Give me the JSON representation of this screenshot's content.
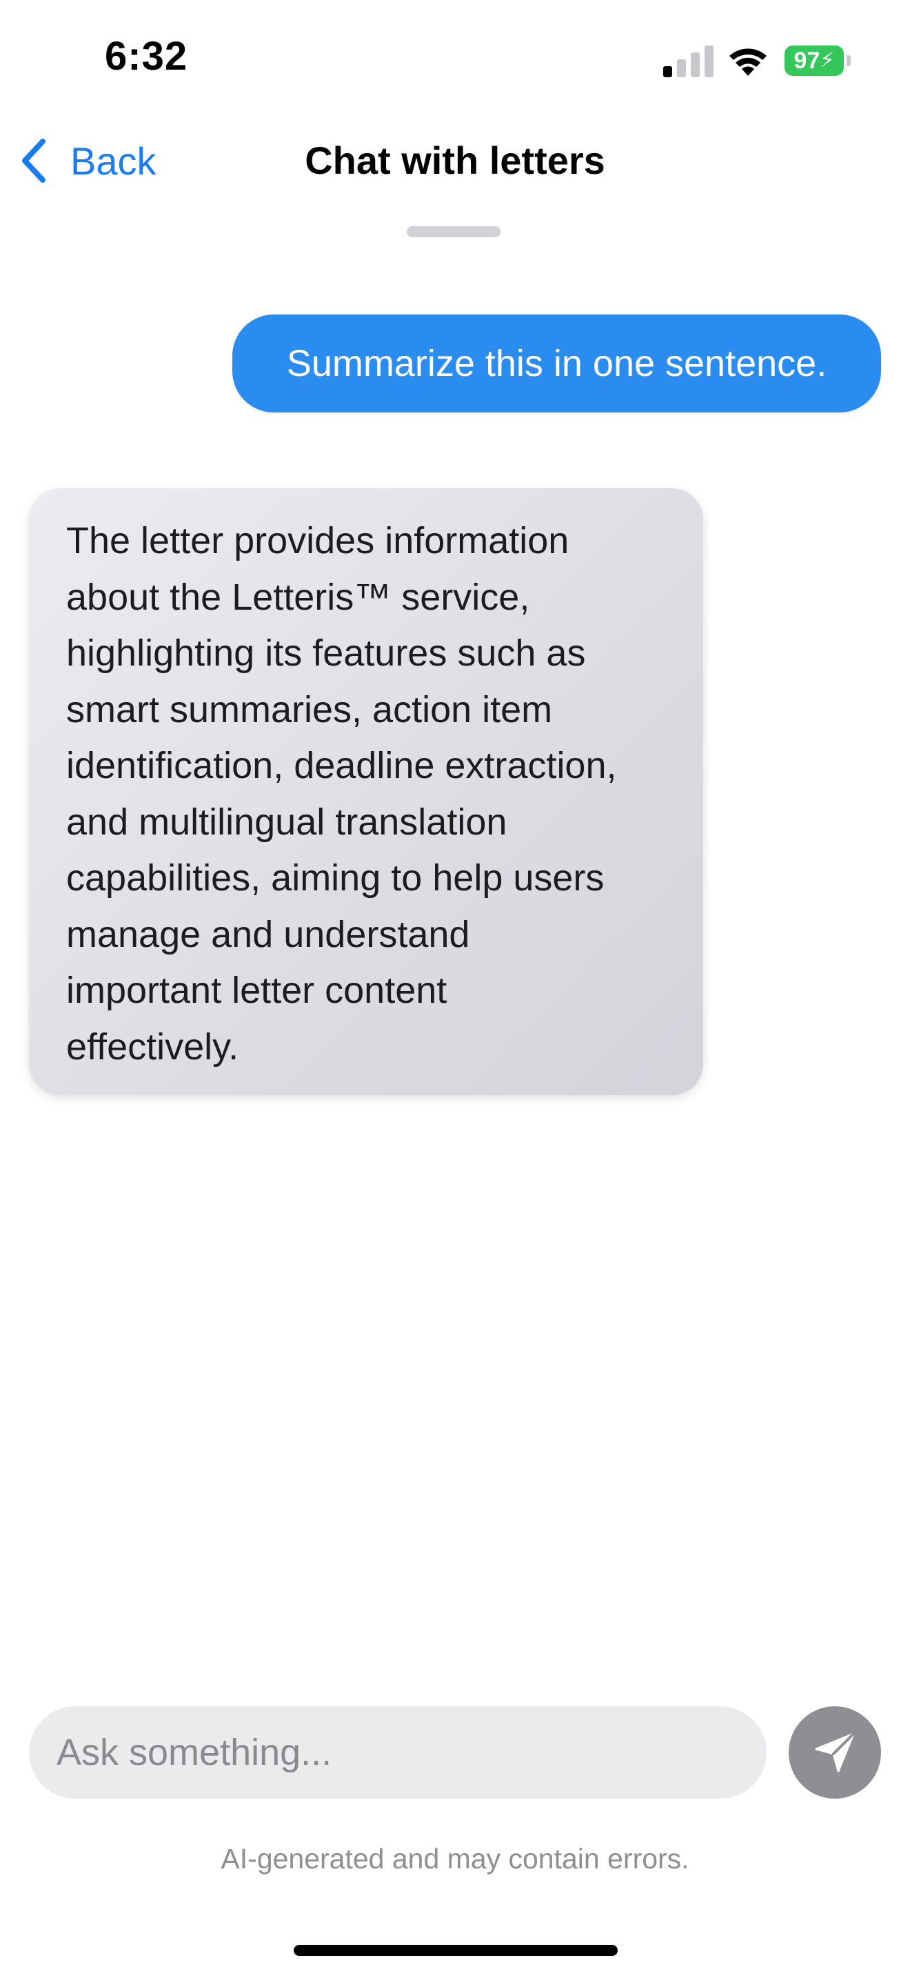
{
  "status_bar": {
    "time": "6:32",
    "battery_level": "97",
    "battery_color": "#34c759",
    "signal_icon": "cellular-signal-icon",
    "wifi_icon": "wifi-icon"
  },
  "nav": {
    "back_label": "Back",
    "back_icon": "chevron-left-icon",
    "title": "Chat with letters",
    "accent_color": "#1a7cf2"
  },
  "messages": [
    {
      "role": "user",
      "text": "Summarize this in one sentence."
    },
    {
      "role": "assistant",
      "lines": [
        "The letter provides information",
        "about the Letteris™ service,",
        "highlighting its features such as",
        "smart summaries, action item",
        "identification, deadline extraction,",
        "and multilingual translation",
        "capabilities, aiming to help users",
        "manage and understand",
        "important letter content",
        "effectively."
      ]
    }
  ],
  "composer": {
    "placeholder": "Ask something...",
    "send_icon": "paper-plane-icon"
  },
  "disclaimer": "AI-generated and may contain errors."
}
